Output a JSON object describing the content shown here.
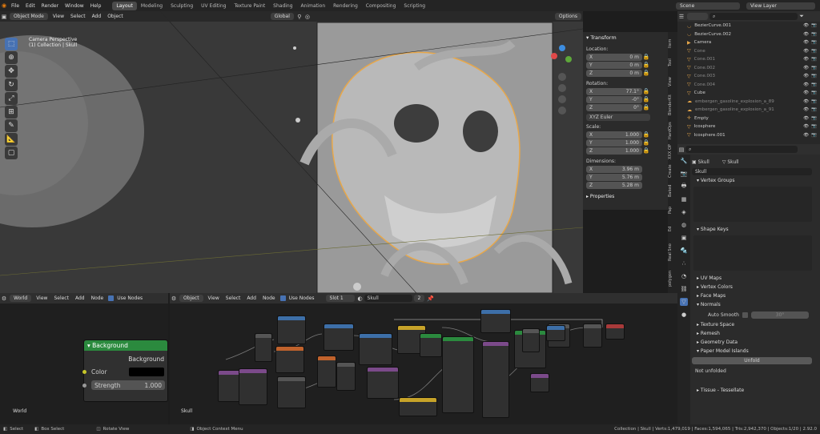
{
  "top_menu": [
    "File",
    "Edit",
    "Render",
    "Window",
    "Help"
  ],
  "workspaces": [
    {
      "label": "Layout",
      "active": true
    },
    {
      "label": "Modeling"
    },
    {
      "label": "Sculpting"
    },
    {
      "label": "UV Editing"
    },
    {
      "label": "Texture Paint"
    },
    {
      "label": "Shading"
    },
    {
      "label": "Animation"
    },
    {
      "label": "Rendering"
    },
    {
      "label": "Compositing"
    },
    {
      "label": "Scripting"
    }
  ],
  "scene": {
    "label": "Scene",
    "view_layer": "View Layer"
  },
  "viewport": {
    "mode": "Object Mode",
    "menus": [
      "View",
      "Select",
      "Add",
      "Object"
    ],
    "orientation": "Global",
    "overlay_title": "Camera Perspective",
    "overlay_sub": "(1) Collection | Skull",
    "options": "Options"
  },
  "transform": {
    "title": "Transform",
    "location_label": "Location:",
    "location": [
      {
        "axis": "X",
        "value": "0 m"
      },
      {
        "axis": "Y",
        "value": "0 m"
      },
      {
        "axis": "Z",
        "value": "0 m"
      }
    ],
    "rotation_label": "Rotation:",
    "rotation": [
      {
        "axis": "X",
        "value": "77.1°"
      },
      {
        "axis": "Y",
        "value": "-0°"
      },
      {
        "axis": "Z",
        "value": "0°"
      }
    ],
    "rotation_mode": "XYZ Euler",
    "scale_label": "Scale:",
    "scale": [
      {
        "axis": "X",
        "value": "1.000"
      },
      {
        "axis": "Y",
        "value": "1.000"
      },
      {
        "axis": "Z",
        "value": "1.000"
      }
    ],
    "dimensions_label": "Dimensions:",
    "dimensions": [
      {
        "axis": "X",
        "value": "3.96 m"
      },
      {
        "axis": "Y",
        "value": "5.76 m"
      },
      {
        "axis": "Z",
        "value": "5.28 m"
      }
    ],
    "properties": "Properties"
  },
  "side_tabs": [
    "Item",
    "Tool",
    "View",
    "BlenderKit",
    "HardOps",
    "XXX OP",
    "Create",
    "Baked",
    "Pap",
    "Ed",
    "Real Sno",
    "polygon"
  ],
  "outliner": [
    {
      "name": "BezierCurve.001"
    },
    {
      "name": "BezierCurve.002"
    },
    {
      "name": "Camera"
    },
    {
      "name": "Cone"
    },
    {
      "name": "Cone.001"
    },
    {
      "name": "Cone.002"
    },
    {
      "name": "Cone.003"
    },
    {
      "name": "Cone.004"
    },
    {
      "name": "Cube"
    },
    {
      "name": "embergen_gasoline_explosion_a_89"
    },
    {
      "name": "embergen_gasoline_explosion_a_91"
    },
    {
      "name": "Empty"
    },
    {
      "name": "Icosphere"
    },
    {
      "name": "Icosphere.001"
    }
  ],
  "properties": {
    "object": "Skull",
    "mesh": "Skull",
    "data_name": "Skull",
    "vertex_groups": "Vertex Groups",
    "shape_keys": "Shape Keys",
    "uv_maps": "UV Maps",
    "vertex_colors": "Vertex Colors",
    "face_maps": "Face Maps",
    "normals": "Normals",
    "auto_smooth": "Auto Smooth",
    "auto_smooth_value": "30°",
    "texture_space": "Texture Space",
    "remesh": "Remesh",
    "geometry_data": "Geometry Data",
    "paper_model": "Paper Model Islands",
    "unfold": "Unfold",
    "not_unfolded": "Not unfolded",
    "tissue": "Tissue - Tessellate"
  },
  "world_editor": {
    "type": "World",
    "menus": [
      "View",
      "Select",
      "Add",
      "Node"
    ],
    "use_nodes": "Use Nodes",
    "node_title": "Background",
    "output": "Background",
    "color_label": "Color",
    "strength_label": "Strength",
    "strength_value": "1.000",
    "footer": "World"
  },
  "shader_editor": {
    "type": "Object",
    "menus": [
      "View",
      "Select",
      "Add",
      "Node"
    ],
    "use_nodes": "Use Nodes",
    "slot": "Slot 1",
    "material": "Skull",
    "users": "2",
    "footer": "Skull"
  },
  "status": {
    "select": "Select",
    "box_select": "Box Select",
    "rotate_view": "Rotate View",
    "context_menu": "Object Context Menu",
    "stats": "Collection | Skull | Verts:1,479,019 | Faces:1,594,065 | Tris:2,942,370 | Objects:1/20 | 2.92.0"
  },
  "colors": {
    "accent": "#4772b3",
    "node_green": "#2b8a3e",
    "orange": "#e7a74a",
    "header": "#303030"
  }
}
